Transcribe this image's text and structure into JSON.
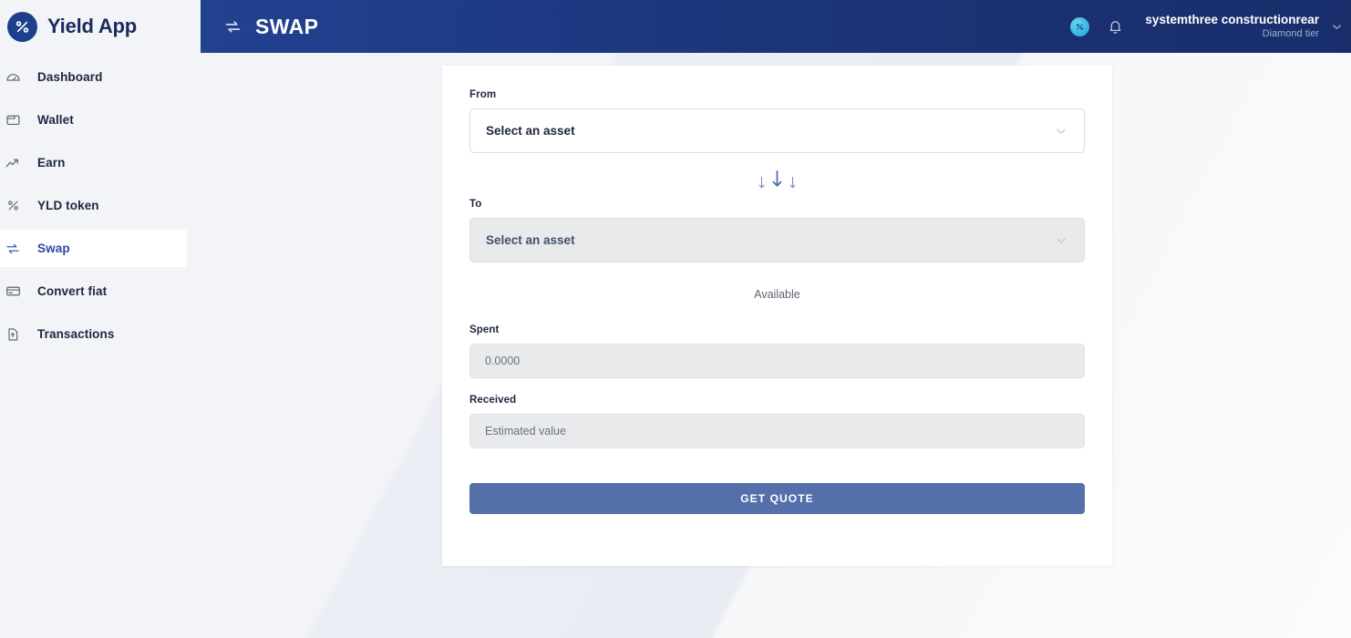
{
  "brand": {
    "name": "Yield App",
    "logo_icon": "percent-logo-icon"
  },
  "sidebar": {
    "items": [
      {
        "label": "Dashboard",
        "icon": "dashboard-gauge-icon",
        "active": false
      },
      {
        "label": "Wallet",
        "icon": "wallet-icon",
        "active": false
      },
      {
        "label": "Earn",
        "icon": "trending-up-icon",
        "active": false
      },
      {
        "label": "YLD token",
        "icon": "percent-icon",
        "active": false
      },
      {
        "label": "Swap",
        "icon": "swap-arrows-icon",
        "active": true
      },
      {
        "label": "Convert fiat",
        "icon": "credit-card-icon",
        "active": false
      },
      {
        "label": "Transactions",
        "icon": "document-icon",
        "active": false
      }
    ]
  },
  "header": {
    "title": "SWAP",
    "title_icon": "swap-arrows-icon",
    "avatar_icon": "user-avatar-icon",
    "bell_icon": "bell-icon",
    "caret_icon": "chevron-down-icon",
    "user": {
      "name": "systemthree constructionrear",
      "tier": "Diamond tier"
    }
  },
  "swap_form": {
    "from": {
      "label": "From",
      "value": "Select an asset",
      "caret_icon": "chevron-down-icon"
    },
    "direction_icon": "triple-down-arrow-icon",
    "to": {
      "label": "To",
      "value": "Select an asset",
      "caret_icon": "chevron-down-icon"
    },
    "available_label": "Available",
    "spent": {
      "label": "Spent",
      "placeholder": "0.0000",
      "value": ""
    },
    "received": {
      "label": "Received",
      "placeholder": "Estimated value",
      "value": ""
    },
    "submit_label": "GET QUOTE"
  },
  "colors": {
    "header_navy": "#1e3a85",
    "brand_navy": "#1b2a5c",
    "active_nav": "#2f4a9b",
    "cta_blue": "#556fab",
    "avatar_cyan": "#3fb9e5"
  }
}
